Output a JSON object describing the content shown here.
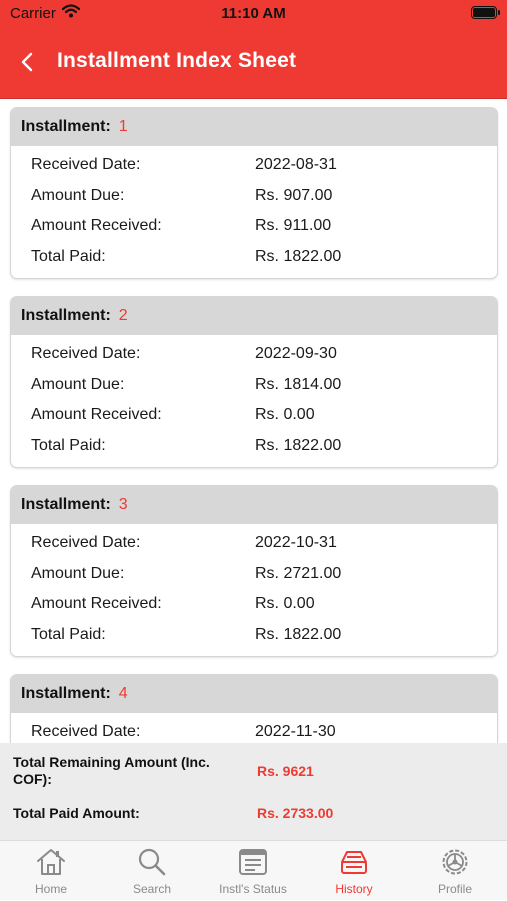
{
  "status_bar": {
    "carrier": "Carrier",
    "time": "11:10 AM"
  },
  "header": {
    "title": "Installment Index Sheet",
    "back_icon": "chevron-left-icon"
  },
  "labels": {
    "installment": "Installment:",
    "received_date": "Received Date:",
    "amount_due": "Amount Due:",
    "amount_received": "Amount Received:",
    "total_paid": "Total Paid:"
  },
  "installments": [
    {
      "number": "1",
      "received_date": "2022-08-31",
      "amount_due": "Rs. 907.00",
      "amount_received": "Rs. 911.00",
      "total_paid": "Rs. 1822.00"
    },
    {
      "number": "2",
      "received_date": "2022-09-30",
      "amount_due": "Rs. 1814.00",
      "amount_received": "Rs. 0.00",
      "total_paid": "Rs. 1822.00"
    },
    {
      "number": "3",
      "received_date": "2022-10-31",
      "amount_due": "Rs. 2721.00",
      "amount_received": "Rs. 0.00",
      "total_paid": "Rs. 1822.00"
    },
    {
      "number": "4",
      "received_date": "2022-11-30",
      "amount_due": "",
      "amount_received": "",
      "total_paid": ""
    }
  ],
  "totals": {
    "remaining_label": "Total Remaining Amount (Inc. COF):",
    "remaining_value": "Rs. 9621",
    "paid_label": "Total Paid Amount:",
    "paid_value": "Rs. 2733.00"
  },
  "tabs": [
    {
      "label": "Home",
      "icon": "home-icon"
    },
    {
      "label": "Search",
      "icon": "search-icon"
    },
    {
      "label": "Instl's Status",
      "icon": "document-icon"
    },
    {
      "label": "History",
      "icon": "history-icon",
      "active": true
    },
    {
      "label": "Profile",
      "icon": "gear-icon"
    }
  ],
  "colors": {
    "accent": "#ef3a33",
    "card_header": "#d7d7d7",
    "totals_bg": "#ececec",
    "tab_inactive": "#8a8a8a"
  }
}
